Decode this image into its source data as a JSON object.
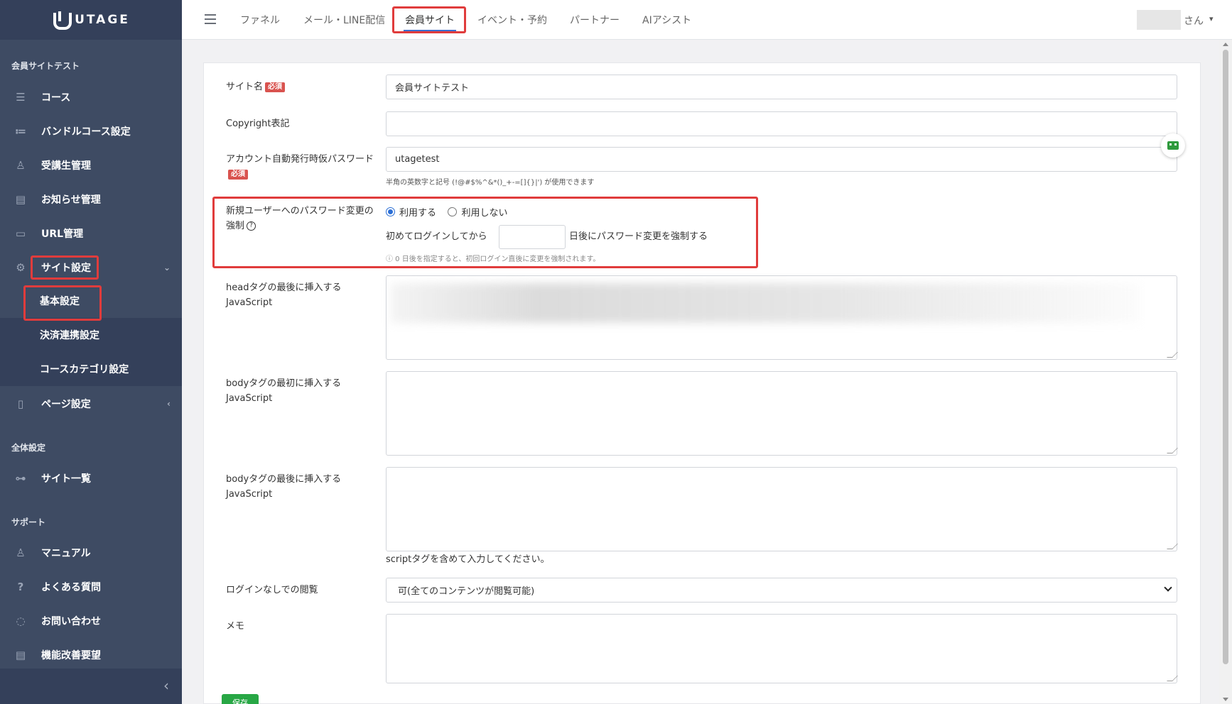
{
  "brand": {
    "name": "UTAGE"
  },
  "sidebar": {
    "section_site": "会員サイトテスト",
    "items": [
      {
        "label": "コース",
        "icon": "list-icon"
      },
      {
        "label": "バンドルコース設定",
        "icon": "bullet-list-icon"
      },
      {
        "label": "受講生管理",
        "icon": "user-icon"
      },
      {
        "label": "お知らせ管理",
        "icon": "newspaper-icon"
      },
      {
        "label": "URL管理",
        "icon": "monitor-link-icon"
      },
      {
        "label": "サイト設定",
        "icon": "gear-icon",
        "caret": "⌄"
      },
      {
        "label": "ページ設定",
        "icon": "page-icon",
        "caret": "‹"
      }
    ],
    "subitems": [
      {
        "label": "基本設定"
      },
      {
        "label": "決済連携設定"
      },
      {
        "label": "コースカテゴリ設定"
      }
    ],
    "section_global": "全体設定",
    "global_items": [
      {
        "label": "サイト一覧",
        "icon": "sitemap-icon"
      }
    ],
    "section_support": "サポート",
    "support_items": [
      {
        "label": "マニュアル",
        "icon": "user-icon"
      },
      {
        "label": "よくある質問",
        "icon": "question-icon"
      },
      {
        "label": "お問い合わせ",
        "icon": "chat-icon"
      },
      {
        "label": "機能改善要望",
        "icon": "document-icon"
      }
    ],
    "collapse": "‹"
  },
  "topnav": {
    "tabs": [
      "ファネル",
      "メール・LINE配信",
      "会員サイト",
      "イベント・予約",
      "パートナー",
      "AIアシスト"
    ],
    "active_tab": "会員サイト",
    "user_suffix": "さん",
    "user_caret": "▾"
  },
  "form": {
    "site_name": {
      "label": "サイト名",
      "required": "必須",
      "value": "会員サイトテスト"
    },
    "copyright": {
      "label": "Copyright表記",
      "value": ""
    },
    "temp_password": {
      "label": "アカウント自動発行時仮パスワード",
      "required": "必須",
      "value": "utagetest",
      "help": "半角の英数字と記号 (!@#$%^&*()_+-=[]{}|') が使用できます"
    },
    "force_change": {
      "label": "新規ユーザーへのパスワード変更の強制",
      "options": [
        "利用する",
        "利用しない"
      ],
      "selected": "利用する",
      "prefix": "初めてログインしてから",
      "days_value": "",
      "suffix": "日後にパスワード変更を強制する",
      "note": "ⓘ 0 日後を指定すると、初回ログイン直後に変更を強制されます。"
    },
    "head_js": {
      "label_line1": "headタグの最後に挿入する",
      "label_line2": "JavaScript"
    },
    "body_start_js": {
      "label_line1": "bodyタグの最初に挿入する",
      "label_line2": "JavaScript"
    },
    "body_end_js": {
      "label_line1": "bodyタグの最後に挿入する",
      "label_line2": "JavaScript",
      "help": "scriptタグを含めて入力してください。"
    },
    "guest_view": {
      "label": "ログインなしでの閲覧",
      "value": "可(全てのコンテンツが閲覧可能)"
    },
    "memo": {
      "label": "メモ",
      "value": ""
    },
    "save_label": "保存"
  },
  "colors": {
    "sidebar": "#3e4b63",
    "sidebar_dark": "#34405a",
    "highlight": "#e03c3c",
    "accent": "#2b6fd6",
    "required": "#d9534f",
    "save": "#28a745"
  }
}
